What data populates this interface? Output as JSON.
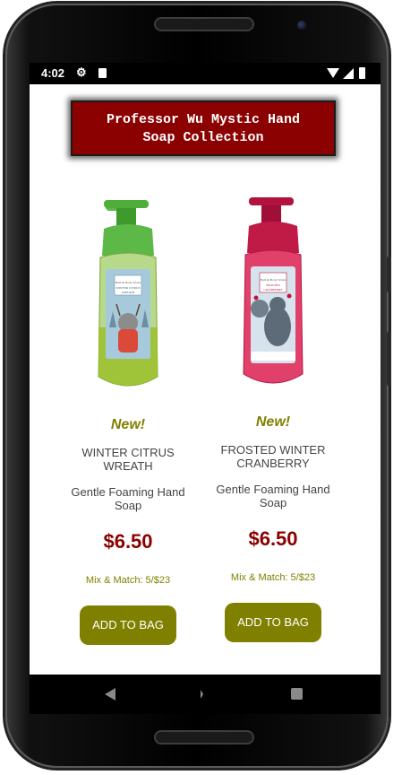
{
  "status_bar": {
    "time": "4:02"
  },
  "header": {
    "title_line1": "Professor Wu Mystic Hand",
    "title_line2": "Soap Collection"
  },
  "products": [
    {
      "badge": "New!",
      "name": "WINTER CITRUS WREATH",
      "description": "Gentle Foaming Hand Soap",
      "price": "$6.50",
      "promo": "Mix & Match: 5/$23",
      "button_label": "ADD TO BAG",
      "label_text": "WINTER CITRUS WREATH",
      "pump_color": "#4fae3a",
      "liquid_color": "#9bbf2a",
      "label_color": "#a7c9dc"
    },
    {
      "badge": "New!",
      "name": "FROSTED WINTER CRANBERRY",
      "description": "Gentle Foaming Hand Soap",
      "price": "$6.50",
      "promo": "Mix & Match: 5/$23",
      "button_label": "ADD TO BAG",
      "label_text": "FROSTED CRANBERRY",
      "pump_color": "#b3123f",
      "liquid_color": "#e0406a",
      "label_color": "#d7e3ec"
    }
  ],
  "colors": {
    "header_bg": "#8b0000",
    "accent_olive": "#808000",
    "price_red": "#8b0000"
  },
  "icons": {
    "settings": "gear-icon",
    "storage": "sd-card-icon",
    "wifi": "wifi-icon",
    "signal": "signal-icon",
    "battery": "battery-icon",
    "back": "back-icon",
    "home": "home-icon",
    "recent": "recent-apps-icon"
  }
}
